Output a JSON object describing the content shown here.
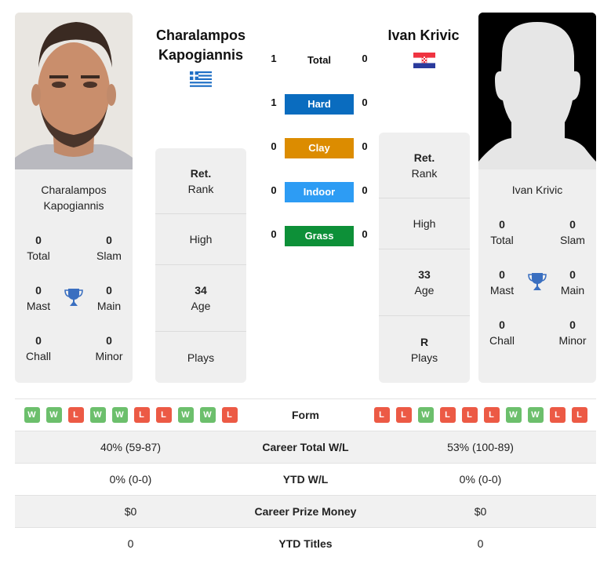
{
  "colors": {
    "hard": "#0a6cbf",
    "clay": "#dc8c00",
    "indoor": "#2d9cf4",
    "grass": "#0d9038",
    "win": "#6cbf6c",
    "loss": "#ec5a45",
    "card_bg": "#efefef",
    "trophy": "#3a6fc0"
  },
  "player1": {
    "name_line1": "Charalampos",
    "name_line2": "Kapogiannis",
    "country_flag": "greece-flag",
    "photo": "player-photo",
    "card_name_line1": "Charalampos",
    "card_name_line2": "Kapogiannis",
    "titles": {
      "total": {
        "value": "0",
        "label": "Total"
      },
      "slam": {
        "value": "0",
        "label": "Slam"
      },
      "mast": {
        "value": "0",
        "label": "Mast"
      },
      "main": {
        "value": "0",
        "label": "Main"
      },
      "chall": {
        "value": "0",
        "label": "Chall"
      },
      "minor": {
        "value": "0",
        "label": "Minor"
      }
    },
    "rank": {
      "value": "Ret.",
      "label": "Rank"
    },
    "high": {
      "value": "",
      "label": "High"
    },
    "age": {
      "value": "34",
      "label": "Age"
    },
    "plays": {
      "value": "",
      "label": "Plays"
    },
    "form": [
      "W",
      "W",
      "L",
      "W",
      "W",
      "L",
      "L",
      "W",
      "W",
      "L"
    ]
  },
  "player2": {
    "name": "Ivan Krivic",
    "country_flag": "croatia-flag",
    "photo": "placeholder-silhouette",
    "card_name": "Ivan Krivic",
    "titles": {
      "total": {
        "value": "0",
        "label": "Total"
      },
      "slam": {
        "value": "0",
        "label": "Slam"
      },
      "mast": {
        "value": "0",
        "label": "Mast"
      },
      "main": {
        "value": "0",
        "label": "Main"
      },
      "chall": {
        "value": "0",
        "label": "Chall"
      },
      "minor": {
        "value": "0",
        "label": "Minor"
      }
    },
    "rank": {
      "value": "Ret.",
      "label": "Rank"
    },
    "high": {
      "value": "",
      "label": "High"
    },
    "age": {
      "value": "33",
      "label": "Age"
    },
    "plays": {
      "value": "R",
      "label": "Plays"
    },
    "form": [
      "L",
      "L",
      "W",
      "L",
      "L",
      "L",
      "W",
      "W",
      "L",
      "L"
    ]
  },
  "h2h": {
    "total": {
      "label": "Total",
      "p1": "1",
      "p2": "0"
    },
    "surfaces": [
      {
        "label": "Hard",
        "p1": "1",
        "p2": "0",
        "color_key": "hard"
      },
      {
        "label": "Clay",
        "p1": "0",
        "p2": "0",
        "color_key": "clay"
      },
      {
        "label": "Indoor",
        "p1": "0",
        "p2": "0",
        "color_key": "indoor"
      },
      {
        "label": "Grass",
        "p1": "0",
        "p2": "0",
        "color_key": "grass"
      }
    ]
  },
  "comparison": {
    "form_label": "Form",
    "rows": [
      {
        "label": "Career Total W/L",
        "p1": "40% (59-87)",
        "p2": "53% (100-89)"
      },
      {
        "label": "YTD W/L",
        "p1": "0% (0-0)",
        "p2": "0% (0-0)"
      },
      {
        "label": "Career Prize Money",
        "p1": "$0",
        "p2": "$0"
      },
      {
        "label": "YTD Titles",
        "p1": "0",
        "p2": "0"
      }
    ]
  }
}
